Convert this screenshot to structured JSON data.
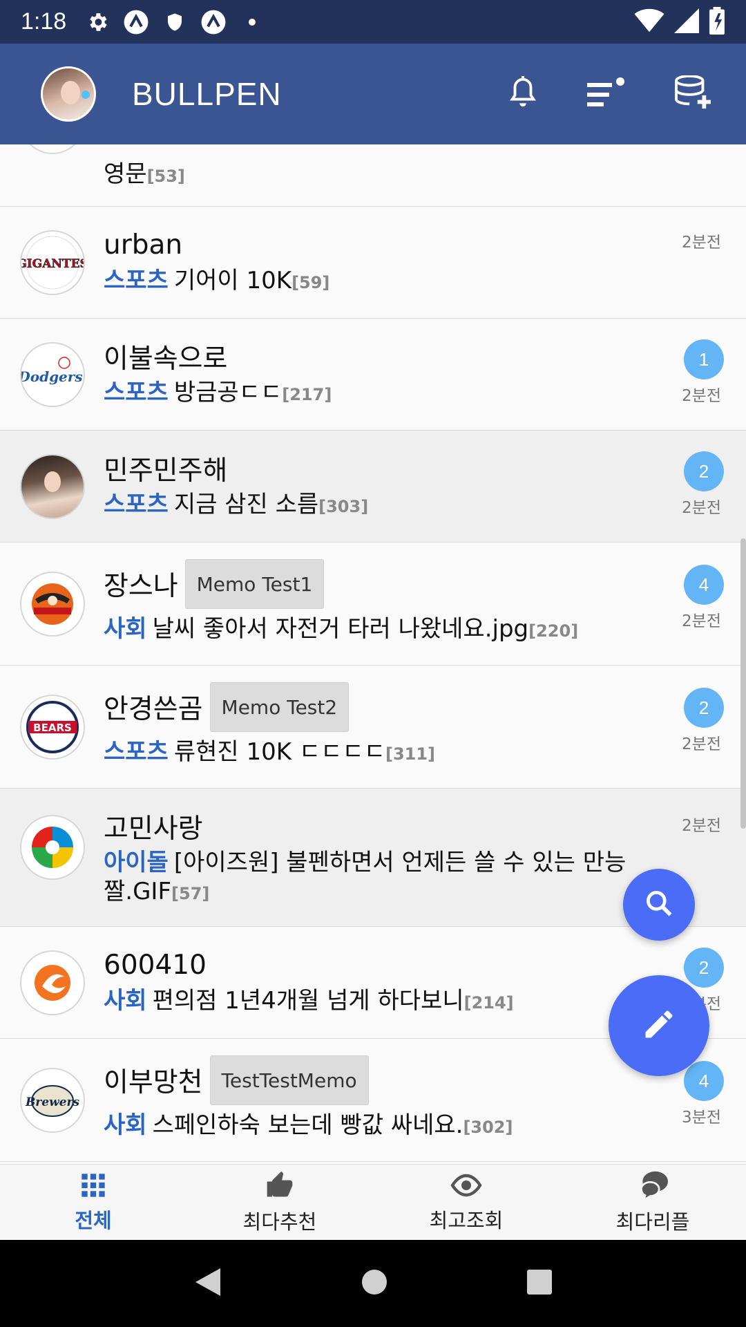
{
  "status": {
    "time": "1:18"
  },
  "app": {
    "title": "BULLPEN"
  },
  "partial_row": {
    "subject": "영문",
    "count": "[53]"
  },
  "rows": [
    {
      "name": "urban",
      "memo": "",
      "category": "스포츠",
      "subject": "기어이 10K",
      "count": "[59]",
      "badge": "",
      "time": "2분전"
    },
    {
      "name": "이불속으로",
      "memo": "",
      "category": "스포츠",
      "subject": "방금공ㄷㄷ",
      "count": "[217]",
      "badge": "1",
      "time": "2분전"
    },
    {
      "name": "민주민주해",
      "memo": "",
      "category": "스포츠",
      "subject": "지금 삼진 소름",
      "count": "[303]",
      "badge": "2",
      "time": "2분전"
    },
    {
      "name": "장스나",
      "memo": "Memo Test1",
      "category": "사회",
      "subject": "날씨 좋아서 자전거 타러 나왔네요.jpg",
      "count": "[220]",
      "badge": "4",
      "time": "2분전"
    },
    {
      "name": "안경쓴곰",
      "memo": "Memo Test2",
      "category": "스포츠",
      "subject": "류현진 10K ㄷㄷㄷㄷ",
      "count": "[311]",
      "badge": "2",
      "time": "2분전"
    },
    {
      "name": "고민사랑",
      "memo": "",
      "category": "아이돌",
      "subject": "[아이즈원] 불펜하면서 언제든 쓸 수 있는 만능 짤.GIF",
      "count": "[57]",
      "badge": "",
      "time": "2분전"
    },
    {
      "name": "600410",
      "memo": "",
      "category": "사회",
      "subject": "편의점 1년4개월 넘게 하다보니",
      "count": "[214]",
      "badge": "2",
      "time": "2분전"
    },
    {
      "name": "이부망천",
      "memo": "TestTestMemo",
      "category": "사회",
      "subject": "스페인하숙 보는데 빵값 싸네요.",
      "count": "[302]",
      "badge": "4",
      "time": "3분전"
    }
  ],
  "nav": [
    {
      "label": "전체",
      "icon": "grid-icon"
    },
    {
      "label": "최다추천",
      "icon": "thumbs-up-icon"
    },
    {
      "label": "최고조회",
      "icon": "eye-icon"
    },
    {
      "label": "최다리플",
      "icon": "chat-bubble-icon"
    }
  ],
  "colors": {
    "statusbar": "#22325a",
    "appbar": "#3a5592",
    "category": "#2a64c4",
    "badge": "#64b5f6",
    "fab": "#4a6cf7"
  }
}
